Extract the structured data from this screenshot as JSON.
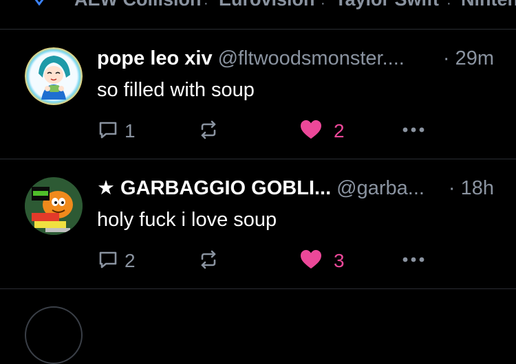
{
  "nav": {
    "items": [
      "AEW Collision",
      "Eurovision",
      "Taylor Swift",
      "Ninten"
    ],
    "icon": "trending-icon"
  },
  "posts": [
    {
      "display_name": "pope leo xiv",
      "handle": "@fltwoodsmonster....",
      "time": "· 29m",
      "text": "so filled with soup",
      "replies": "1",
      "reposts": "",
      "likes": "2",
      "liked": true,
      "avatar": "anime-avatar"
    },
    {
      "display_name": "★ GARBAGGIO GOBLI...",
      "handle": "@garba...",
      "time": "· 18h",
      "text": "holy fuck i love soup",
      "replies": "2",
      "reposts": "",
      "likes": "3",
      "liked": true,
      "avatar": "garfield-avatar"
    }
  ],
  "colors": {
    "background": "#000000",
    "muted": "#8a93a0",
    "like": "#ec4899",
    "divider": "#2a2d33"
  }
}
